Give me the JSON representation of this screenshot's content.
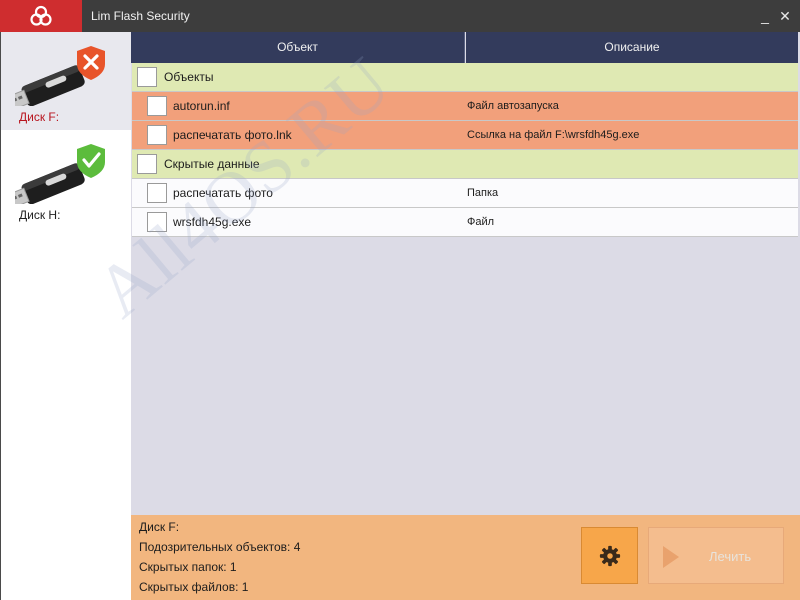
{
  "window": {
    "title": "Lim Flash Security",
    "minimize_glyph": "_",
    "close_glyph": "✕",
    "logo_icon": "lim-logo-icon",
    "accent_color": "#cf2d2f"
  },
  "sidebar": {
    "drives": [
      {
        "label": "Диск F:",
        "status": "infected",
        "icon": "usb-drive-infected-icon",
        "selected": true
      },
      {
        "label": "Диск H:",
        "status": "clean",
        "icon": "usb-drive-clean-icon",
        "selected": false
      }
    ]
  },
  "table": {
    "columns": [
      "Объект",
      "Описание"
    ],
    "groups": [
      {
        "label": "Объекты",
        "items": [
          {
            "name": "autorun.inf",
            "description": "Файл автозапуска",
            "severity": "threat"
          },
          {
            "name": "распечатать фото.lnk",
            "description": "Ссылка на файл F:\\wrsfdh45g.exe",
            "severity": "threat"
          }
        ]
      },
      {
        "label": "Скрытые данные",
        "items": [
          {
            "name": "распечатать фото",
            "description": "Папка",
            "severity": "normal"
          },
          {
            "name": "wrsfdh45g.exe",
            "description": "Файл",
            "severity": "normal"
          }
        ]
      }
    ]
  },
  "watermark": "All4OS.RU",
  "status": {
    "drive": "Диск F:",
    "suspicious": "Подозрительных объектов: 4",
    "hidden_folders": "Скрытых папок: 1",
    "hidden_files": "Скрытых файлов: 1"
  },
  "buttons": {
    "settings_icon": "gear-icon",
    "heal_label": "Лечить",
    "heal_enabled": false
  }
}
